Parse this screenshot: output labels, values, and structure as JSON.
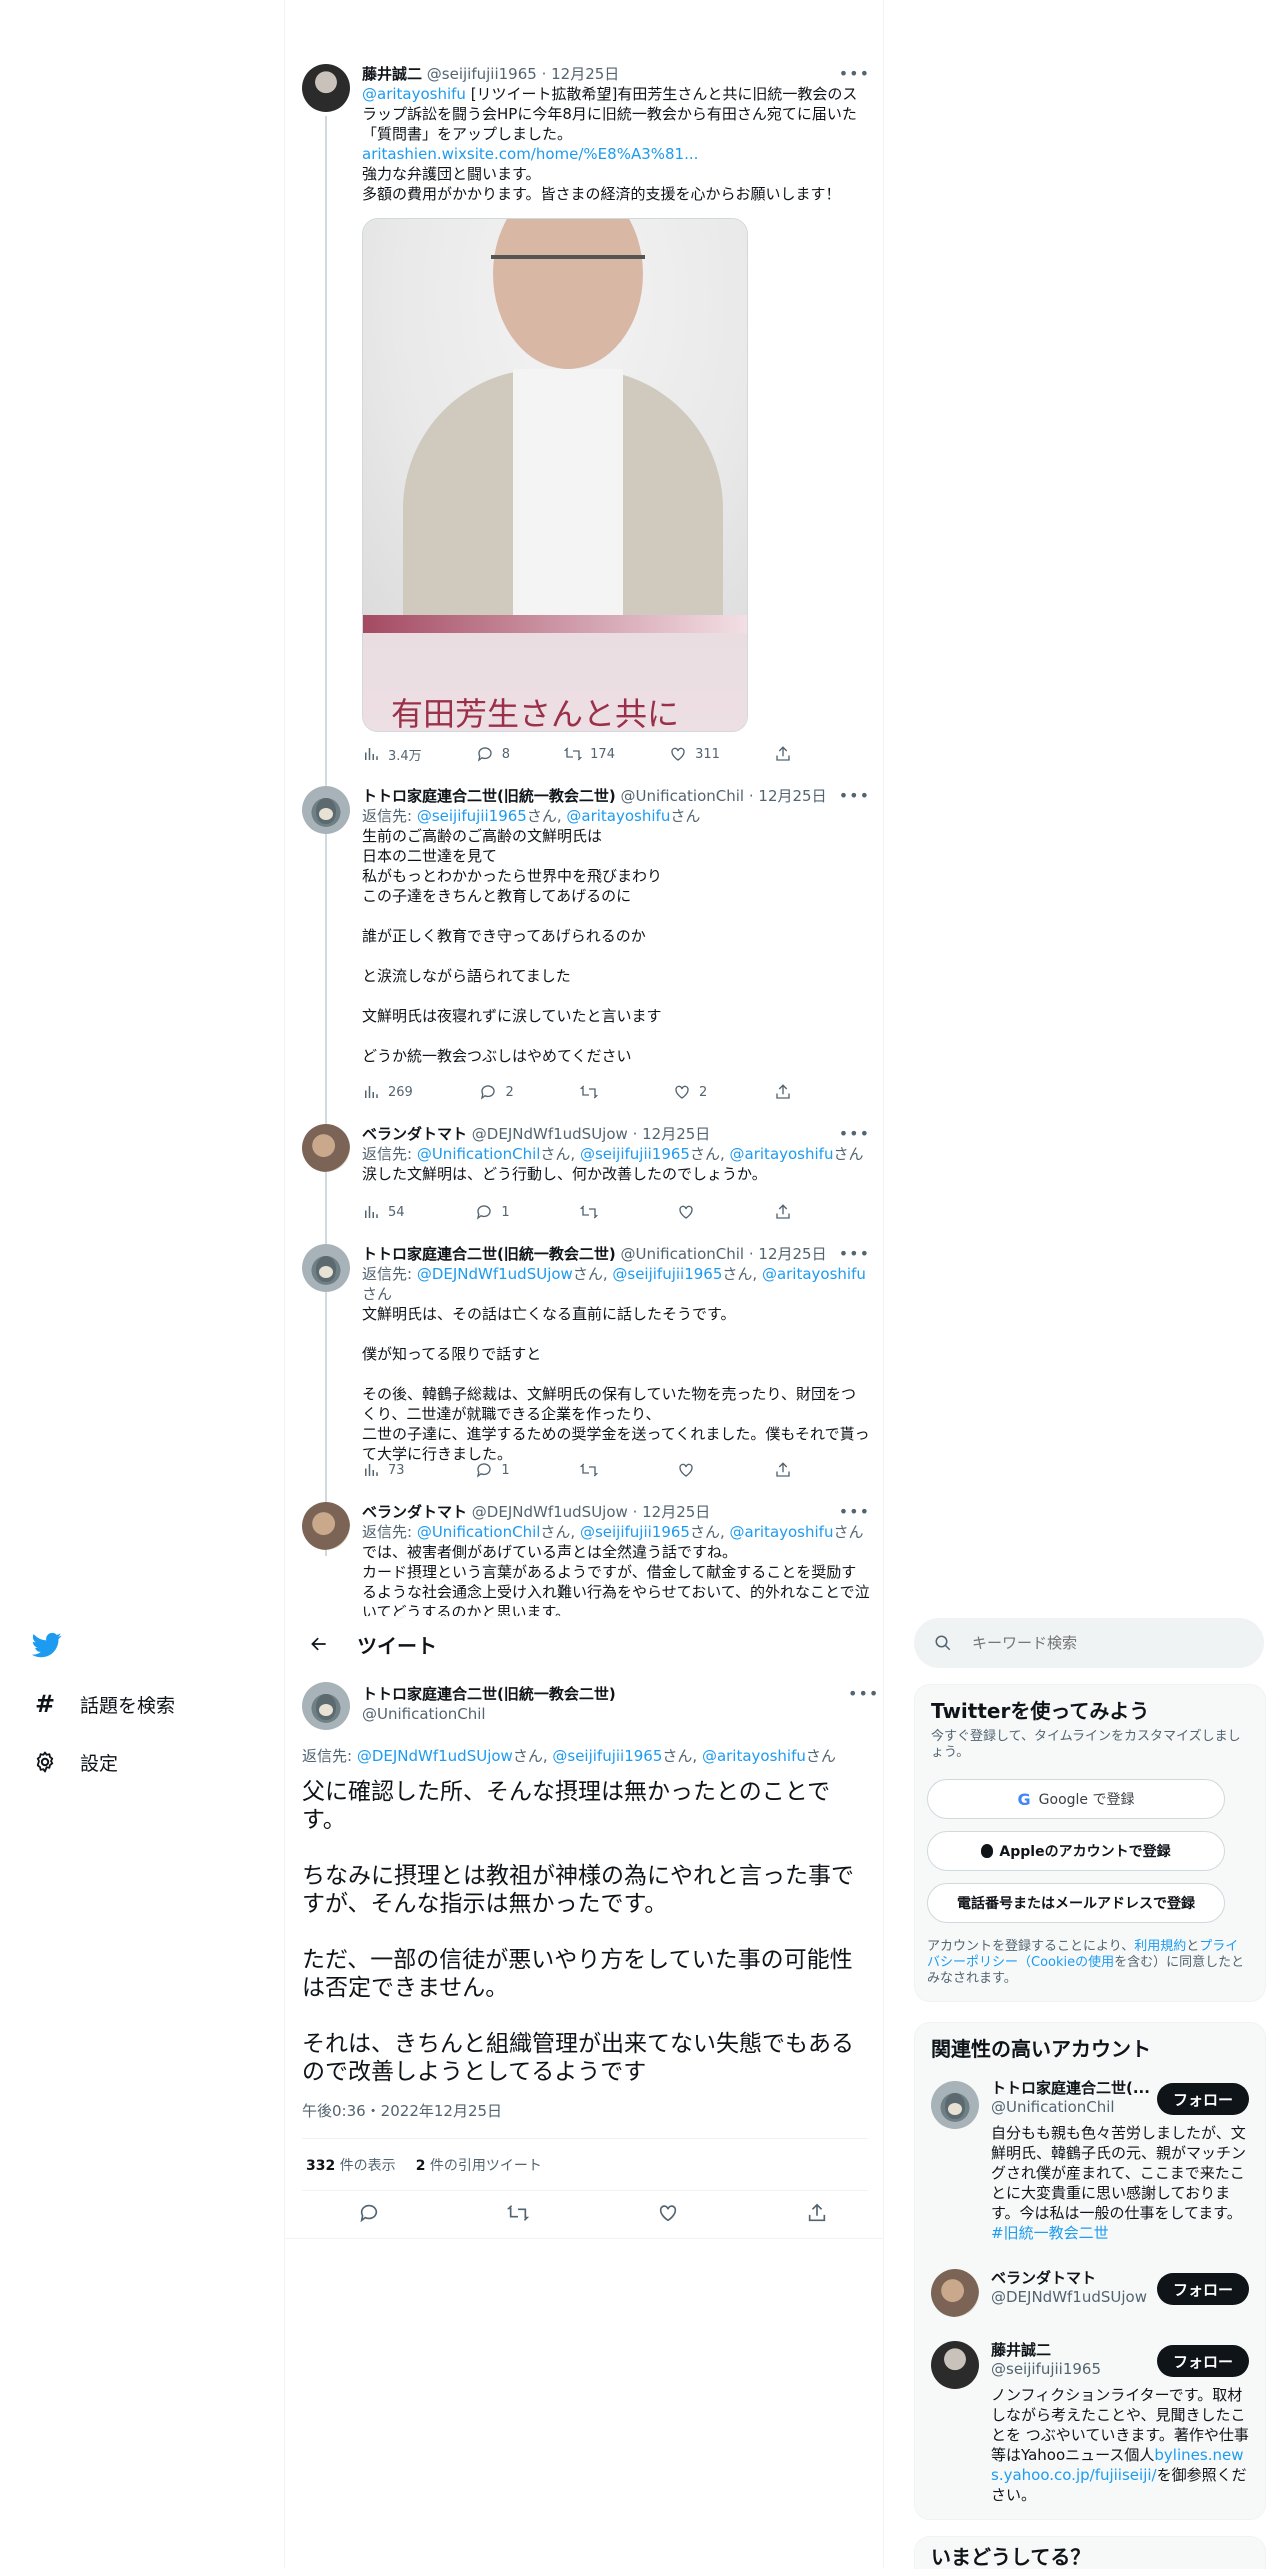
{
  "nav": {
    "items": [
      {
        "label": "話題を検索",
        "icon": "hashtag-icon"
      },
      {
        "label": "設定",
        "icon": "gear-icon"
      }
    ]
  },
  "thread": [
    {
      "name": "藤井誠二",
      "handle": "@seijifujii1965",
      "date": "12月25日",
      "body_mention": "@aritayoshifu",
      "body_text": " [リツイート拡散希望]有田芳生さんと共に旧統一教会のスラップ訴訟を闘う会HPに今年8月に旧統一教会から有田さん宛てに届いた「質問書」をアップしました。",
      "body_link": "aritashien.wixsite.com/home/%E8%A3%81...",
      "body_after": "強力な弁護団と闘います。\n多額の費用がかかります。皆さまの経済的支援を心からお願いします！",
      "image_caption": "有田芳生さんと共に",
      "stats": {
        "views": "3.4万",
        "replies": "8",
        "retweets": "174",
        "likes": "311"
      }
    },
    {
      "name": "トトロ家庭連合二世(旧統一教会二世)",
      "handle": "@UnificationChil",
      "date": "12月25日",
      "reply_prefix": "返信先: ",
      "reply_to": [
        "@seijifujii1965",
        "@aritayoshifu"
      ],
      "body": "生前のご高齢のご高齢の文鮮明氏は\n日本の二世達を見て\n私がもっとわかかったら世界中を飛びまわり\nこの子達をきちんと教育してあげるのに\n\n誰が正しく教育でき守ってあげられるのか\n\nと涙流しながら語られてました\n\n文鮮明氏は夜寝れずに涙していたと言います\n\nどうか統一教会つぶしはやめてください",
      "stats": {
        "views": "269",
        "replies": "2",
        "retweets": "",
        "likes": "2"
      }
    },
    {
      "name": "ベランダトマト",
      "handle": "@DEJNdWf1udSUjow",
      "date": "12月25日",
      "reply_prefix": "返信先: ",
      "reply_to": [
        "@UnificationChil",
        "@seijifujii1965",
        "@aritayoshifu"
      ],
      "body": "涙した文鮮明は、どう行動し、何か改善したのでしょうか。",
      "stats": {
        "views": "54",
        "replies": "1",
        "retweets": "",
        "likes": ""
      }
    },
    {
      "name": "トトロ家庭連合二世(旧統一教会二世)",
      "handle": "@UnificationChil",
      "date": "12月25日",
      "reply_prefix": "返信先: ",
      "reply_to": [
        "@DEJNdWf1udSUjow",
        "@seijifujii1965",
        "@aritayoshifu"
      ],
      "body": "文鮮明氏は、その話は亡くなる直前に話したそうです。\n\n僕が知ってる限りで話すと\n\nその後、韓鶴子総裁は、文鮮明氏の保有していた物を売ったり、財団をつくり、二世達が就職できる企業を作ったり、\n二世の子達に、進学するための奨学金を送ってくれました。僕もそれで貰って大学に行きました。",
      "stats": {
        "views": "73",
        "replies": "1",
        "retweets": "",
        "likes": ""
      }
    },
    {
      "name": "ベランダトマト",
      "handle": "@DEJNdWf1udSUjow",
      "date": "12月25日",
      "reply_prefix": "返信先: ",
      "reply_to": [
        "@UnificationChil",
        "@seijifujii1965",
        "@aritayoshifu"
      ],
      "body": "では、被害者側があげている声とは全然違う話ですね。\nカード摂理という言葉があるようですが、借金して献金することを奨励するような社会通念上受け入れ難い行為をやらせておいて、的外れなことで泣いてどうするのかと思います。"
    }
  ],
  "header": {
    "title": "ツイート"
  },
  "main_tweet": {
    "name": "トトロ家庭連合二世(旧統一教会二世)",
    "handle": "@UnificationChil",
    "reply_prefix": "返信先: ",
    "reply_to": [
      "@DEJNdWf1udSUjow",
      "@seijifujii1965",
      "@aritayoshifu"
    ],
    "body": "父に確認した所、そんな摂理は無かったとのことです。\n\nちなみに摂理とは教祖が神様の為にやれと言った事ですが、そんな指示は無かったです。\n\nただ、一部の信徒が悪いやり方をしていた事の可能性は否定できません。\n\nそれは、きちんと組織管理が出来てない失態でもあるので改善しようとしてるようです",
    "timestamp": "午後0:36・2022年12月25日",
    "views_count": "332",
    "views_label": "件の表示",
    "quotes_count": "2",
    "quotes_label": "件の引用ツイート"
  },
  "search": {
    "placeholder": "キーワード検索"
  },
  "signup": {
    "title": "Twitterを使ってみよう",
    "subtitle": "今すぐ登録して、タイムラインをカスタマイズしましょう。",
    "google": "Google で登録",
    "apple": "Appleのアカウントで登録",
    "phone": "電話番号またはメールアドレスで登録",
    "legal_1": "アカウントを登録することにより、",
    "legal_link_1": "利用規約",
    "legal_2": "と",
    "legal_link_2": "プライバシーポリシー（Cookieの使用",
    "legal_3": "を含む）に同意したとみなされます。"
  },
  "related": {
    "title": "関連性の高いアカウント",
    "follow_label": "フォロー",
    "accounts": [
      {
        "name": "トトロ家庭連合二世(...",
        "handle": "@UnificationChil",
        "bio": "自分もも親も色々苦労しましたが、文鮮明氏、韓鶴子氏の元、親がマッチングされ僕が産まれて、ここまで来たことに大変貴重に思い感謝しております。今は私は一般の仕事をしてます。",
        "bio_link": "#旧統一教会二世"
      },
      {
        "name": "ベランダトマト",
        "handle": "@DEJNdWf1udSUjow"
      },
      {
        "name": "藤井誠二",
        "handle": "@seijifujii1965",
        "bio": "ノンフィクションライターです。取材しながら考えたことや、見聞きしたことを つぶやいていきます。著作や仕事等はYahooニュース個人",
        "bio_link": "bylines.news.yahoo.co.jp/fujiiseiji/",
        "bio_after": "を御参照ください。"
      }
    ]
  },
  "trending": {
    "title": "いまどうしてる？"
  },
  "colors": {
    "accent": "#1d9bf0",
    "text": "#0f1419",
    "muted": "#536471",
    "border": "#eff3f4",
    "image_caption": "#9a3049"
  }
}
